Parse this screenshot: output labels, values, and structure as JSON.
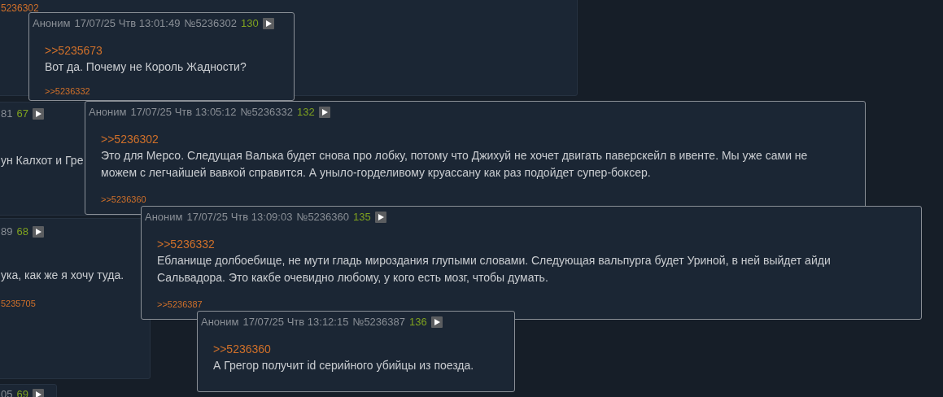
{
  "background_posts": [
    {
      "backlink": "5236302"
    },
    {
      "number_tail": "81",
      "count": "67",
      "text": "ун Калхот и Гре"
    },
    {
      "number_tail": "89",
      "count": "68",
      "text": "ука, как же я хочу туда.",
      "backlink": "5235705"
    },
    {
      "number_tail": "05",
      "count": "69"
    }
  ],
  "popups": [
    {
      "name": "Аноним",
      "date": "17/07/25 Чтв 13:01:49",
      "number": "№5236302",
      "count": "130",
      "reply_to": ">>5235673",
      "text": "Вот да. Почему не Король Жадности?",
      "replies": [
        ">>5236332"
      ]
    },
    {
      "name": "Аноним",
      "date": "17/07/25 Чтв 13:05:12",
      "number": "№5236332",
      "count": "132",
      "reply_to": ">>5236302",
      "text": "Это для Мерсо. Следущая Валька будет снова про лобку, потому что Джихуй не хочет двигать паверскейл в ивенте. Мы уже сами не можем с легчайшей вавкой справится. А уныло-горделивому круассану как раз подойдет супер-боксер.",
      "replies": [
        ">>5236360"
      ]
    },
    {
      "name": "Аноним",
      "date": "17/07/25 Чтв 13:09:03",
      "number": "№5236360",
      "count": "135",
      "reply_to": ">>5236332",
      "text": "Ебланище долбоебище, не мути гладь мироздания глупыми словами. Следующая вальпурга будет Уриной, в ней выйдет айди Сальвадора. Это какбе очевидно любому, у кого есть мозг, чтобы думать.",
      "replies": [
        ">>5236387"
      ]
    },
    {
      "name": "Аноним",
      "date": "17/07/25 Чтв 13:12:15",
      "number": "№5236387",
      "count": "136",
      "reply_to": ">>5236360",
      "text": "А Грегор получит id серийного убийцы из поезда."
    }
  ]
}
